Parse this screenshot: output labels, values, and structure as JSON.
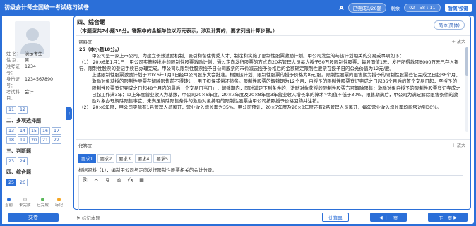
{
  "header": {
    "title": "初级会计师全国统一考试练习试卷",
    "font_icon": "A",
    "progress": "已完成0/26题",
    "timer_label": "剩余",
    "timer": "02 : 58 : 11",
    "hotkey_button": "暂离/按键"
  },
  "candidate": {
    "rows": [
      {
        "k": "姓    名：",
        "v": "演示考生"
      },
      {
        "k": "性    别：",
        "v": "男"
      },
      {
        "k": "准考证号：",
        "v": "1234"
      },
      {
        "k": "身份证号：",
        "v": "1234567890"
      },
      {
        "k": "考试科目：",
        "v": "会计"
      }
    ]
  },
  "nav": {
    "partial_top": [
      "11",
      "12"
    ],
    "section2": {
      "title": "二、多项选择题",
      "items": [
        "13",
        "14",
        "15",
        "16",
        "17",
        "18",
        "19",
        "20",
        "21",
        "22"
      ]
    },
    "section3": {
      "title": "三、判断题",
      "items": [
        "23",
        "24"
      ]
    },
    "section4": {
      "title": "四、综合题",
      "items": [
        "25",
        "26"
      ]
    },
    "current": "25"
  },
  "legend": [
    {
      "label": "当前",
      "color": "#2b6fd8"
    },
    {
      "label": "未完成",
      "color": "#f0f0f0"
    },
    {
      "label": "已完成",
      "color": "#5ab85a"
    },
    {
      "label": "标记",
      "color": "#f5a623"
    }
  ],
  "submit_label": "交卷",
  "question": {
    "section_title": "四、综合题",
    "instruction": "（本题型共2小题36分。答案中的金额单位以万元表示，涉及计算的，要求列出计算步骤。）",
    "lang_toggle": "简体(简体)",
    "material_label": "资料区",
    "expand_label": "放大",
    "material": {
      "heading": "25（本小题18分。）",
      "intro": "甲公司是一家上市公司，为建立长效激励机制，吸引和留住优秀人才，制定和实施了限制性股票激励计划。甲公司发生的与该计划相关的交易或事项如下：",
      "p1": "（1） 20×6年1月1日，甲公司实施经批准的限制性股票激励计划，通过定向发行股票的方式向20名管理人员每人授予50万股限制性股票，每股面值1元，发行所得款项8000万元已存入银行，限制性股票的登记手续已办理完成。甲公司以限制性股票授予日公司股票的市价减去授予价格后的金额确定限制性股票在授予日的公允价值为12元/股。",
      "p1b": "上述限制性股票激励计划于20×6年1月1日经甲公司股东大会批准。根据该计划，限制性股票的授予价格为8元/股。限制性股票的限售期为授予的限制性股票登记完成之日起36个月，激励对象获授的限制性股票在解除限售前不得转让，用于担保或偿还债务。限制性股票的解锁期为12个月，自授予的限制性股票登记完成之日起36个月后的首个交易日起，至授予的限制性股票登记完成之日起48个月内的最后一个交易日当日止，解锁期内，同时满足下列条件的，激励对象获授的限制性股票方可解除限售：激励对象自授予的限制性股票登记完成之日起工作满3年；以上年度营业收入为基数，甲公司20×6年度、20×7年度及20×8年度3年营业收入增长率的算术平均值不低于30%。限售期满后，甲公司为满足解除限售条件的激励对象办理解除限售事宜，未满足解除限售条件的激励对象持有的限制性股票由甲公司按照授予价格回购并注销。",
      "p2": "（2） 20×6年度，甲公司实际有1名管理人员离开，营业收入增长率为35%。甲公司预计，20×7年度及20×8年度还有2名管理人员离开，每年营业收入增长率均能够达到30%。",
      "p3": "（3） 20×7年度，甲公司没有管理人员离开，营业收入增长率为33%，甲公司预计，20×8年度有1名管理人员离开，营业收入增长率能够达到36%。"
    },
    "answer_label": "作答区",
    "tabs": [
      "要求1",
      "要求2",
      "要求3",
      "要求4",
      "要求5"
    ],
    "active_tab": "要求1",
    "prompt": "根据资料（1），编制甲公司与定向发行限制性股票相关的会计分录。",
    "toolbar": [
      "⎘",
      "✂",
      "⧉",
      "⎌",
      "√x",
      "▦"
    ]
  },
  "footer": {
    "mark_label": "标记本题",
    "calc_label": "计算器",
    "prev_label": "上一页",
    "next_label": "下一页"
  }
}
